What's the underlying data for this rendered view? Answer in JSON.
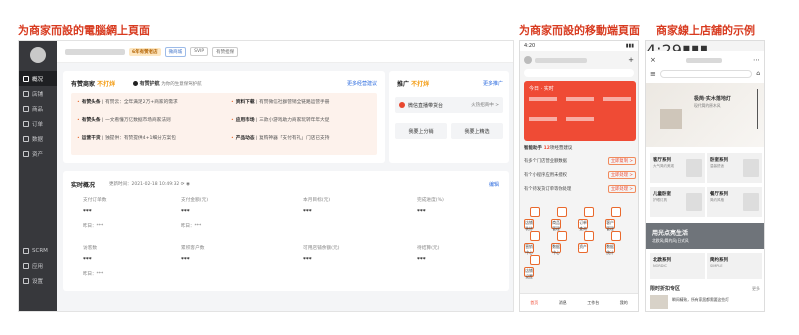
{
  "captions": {
    "desktop": "为商家而設的電腦網上頁面",
    "mobile": "为商家而設的移動端頁面",
    "store": "商家線上店舖的示例"
  },
  "desktop": {
    "sidebar": [
      {
        "label": "概况",
        "icon": "overview-icon",
        "active": true
      },
      {
        "label": "店铺",
        "icon": "store-icon"
      },
      {
        "label": "商品",
        "icon": "goods-icon"
      },
      {
        "label": "订单",
        "icon": "order-icon"
      },
      {
        "label": "数据",
        "icon": "chart-icon"
      },
      {
        "label": "资产",
        "icon": "wallet-icon"
      },
      {
        "label": "SCRM",
        "icon": "scrm-icon"
      },
      {
        "label": "应用",
        "icon": "apps-icon"
      },
      {
        "label": "设置",
        "icon": "settings-icon"
      }
    ],
    "topbar": {
      "tag_level": "6年有赞老店",
      "tag_cert": "微商城",
      "tag_svip": "SVIP",
      "tag_guarantee": "有赞担保"
    },
    "merchant": {
      "title": "有赞商家",
      "title_status": "不打烊",
      "protect_label": "有赞护航",
      "protect_desc": "为你的生意保驾护航",
      "more_link": "更多经营建议",
      "features": [
        {
          "name": "有赞头条",
          "desc": "有赞云：全年满足2万+商家的需求"
        },
        {
          "name": "资料下载",
          "desc": "有赞微信社群营销全链路运营手册"
        },
        {
          "name": "有赞头条",
          "desc": "一文看懂万亿数据市场商家法则"
        },
        {
          "name": "应用市场",
          "desc": "三款小游戏助力商家玩转年年大促"
        },
        {
          "name": "运营干货",
          "desc": "独提供：有赞提供4+1细分方案包"
        },
        {
          "name": "产品动态",
          "desc": "复购神器「支付有礼」门店已支持"
        }
      ]
    },
    "promo": {
      "title": "推广",
      "status": "不打烊",
      "more_link": "更多推广",
      "channel": "微信直播带货台",
      "channel_note": "火热招商中 >",
      "btn_distribution": "我要上分销",
      "btn_selection": "我要上精选"
    },
    "realtime": {
      "title": "实时概况",
      "update_label": "更新时间：",
      "update_time": "2021-02-18 10:49:32",
      "edit": "编辑",
      "metrics": [
        {
          "label": "支付订单数",
          "value": "***",
          "yesterday": "昨日：***"
        },
        {
          "label": "支付金额(元)",
          "value": "***",
          "yesterday": "昨日：***"
        },
        {
          "label": "本月目标(元)",
          "value": "***"
        },
        {
          "label": "完成进度(%)",
          "value": "***"
        },
        {
          "label": "访客数",
          "value": "***",
          "yesterday": "昨日：***"
        },
        {
          "label": "累积客户数",
          "value": "***"
        },
        {
          "label": "可用店铺余额(元)",
          "value": "***"
        },
        {
          "label": "待结算(元)",
          "value": "***"
        }
      ]
    }
  },
  "mobile": {
    "time": "4:20",
    "today_label": "今日",
    "today_status": "实时",
    "help": "智能助手",
    "help_count": "12",
    "help_more": "项经营建议",
    "tasks": [
      {
        "text": "有多个门店营业额数据",
        "btn": "立即复制 >"
      },
      {
        "text": "有个小程序应用未授权",
        "btn": "立即处理 >"
      },
      {
        "text": "有个待发货订单等你处理",
        "btn": "立即处理 >"
      }
    ],
    "grid": [
      "店铺装修",
      "商品管理",
      "订单查询",
      "客户管理",
      "营销中心",
      "数据中心",
      "资产",
      "数据统计",
      "店铺设置"
    ],
    "tabs": [
      "首页",
      "消息",
      "工作台",
      "我的"
    ]
  },
  "store": {
    "time": "4:29",
    "banner_title": "极简·实木落地灯",
    "banner_sub": "现代简约原木风",
    "products": [
      {
        "title": "客厅系列",
        "sub": "大气简约美观"
      },
      {
        "title": "卧室系列",
        "sub": "温馨舒适"
      },
      {
        "title": "儿童卧室",
        "sub": "护眼灯具"
      },
      {
        "title": "餐厅系列",
        "sub": "简约风格"
      }
    ],
    "section_title": "用光点亮生活",
    "section_sub": "北欧风|简约风|日式风",
    "items": [
      {
        "title": "北欧系列",
        "sub": "NORDIC"
      },
      {
        "title": "简约系列",
        "sub": "SIMPLE"
      }
    ],
    "sale_title": "限时折扣专区",
    "sale_more": "更多",
    "sale_item": "瞬间精致，所有家居都需要这些灯"
  }
}
